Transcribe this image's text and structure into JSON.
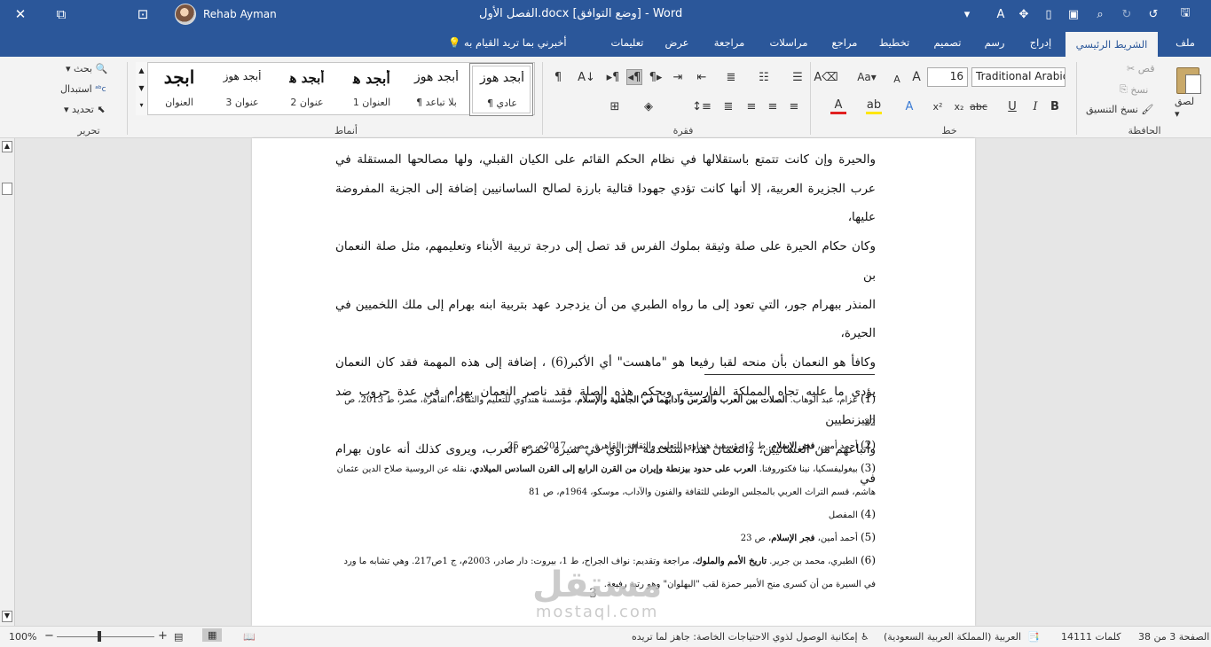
{
  "titlebar": {
    "title": "الفصل الأول.docx  [وضع التوافق]  -  Word",
    "user": "Rehab Ayman",
    "close": "✕",
    "restore": "⧉",
    "ribbon_display": "⊡"
  },
  "tabs": [
    {
      "label": "ملف",
      "active": false
    },
    {
      "label": "الشريط الرئيسي",
      "active": true
    },
    {
      "label": "إدراج",
      "active": false
    },
    {
      "label": "رسم",
      "active": false
    },
    {
      "label": "تصميم",
      "active": false
    },
    {
      "label": "تخطيط",
      "active": false
    },
    {
      "label": "مراجع",
      "active": false
    },
    {
      "label": "مراسلات",
      "active": false
    },
    {
      "label": "مراجعة",
      "active": false
    },
    {
      "label": "عرض",
      "active": false
    },
    {
      "label": "تعليمات",
      "active": false
    }
  ],
  "tellme": "أخبرني بما تريد القيام به",
  "ribbon": {
    "clipboard": {
      "label": "الحافظة",
      "paste": "لصق",
      "cut": "قص",
      "copy": "نسخ",
      "format_painter": "نسخ التنسيق"
    },
    "font": {
      "label": "خط",
      "font_name": "Traditional Arabic",
      "font_size": "16"
    },
    "paragraph": {
      "label": "فقرة"
    },
    "styles": {
      "label": "أنماط",
      "items": [
        {
          "preview": "أبجد هوز",
          "name": "¶ عادي"
        },
        {
          "preview": "أبجد هوز",
          "name": "¶ بلا تباعد"
        },
        {
          "preview": "أبجد ﮬ",
          "name": "العنوان 1"
        },
        {
          "preview": "أبجد ﮬ",
          "name": "عنوان 2"
        },
        {
          "preview": "أبجد هوز",
          "name": "عنوان 3"
        },
        {
          "preview": "ابجد",
          "name": "العنوان"
        }
      ]
    },
    "editing": {
      "label": "تحرير",
      "find": "بحث",
      "replace": "استبدال",
      "select": "تحديد"
    }
  },
  "document": {
    "body_lines": [
      "والحيرة وإن كانت تتمتع باستقلالها في نظام الحكم القائم على الكيان القبلي، ولها مصالحها المستقلة في",
      "عرب الجزيرة العربية، إلا أنها كانت تؤدي جهودا قتالية بارزة لصالح الساسانيين إضافة إلى الجزية المفروضة عليها،",
      "وكان حكام الحيرة على صلة وثيقة بملوك الفرس قد تصل إلى درجة تربية الأبناء وتعليمهم، مثل صلة النعمان بن",
      "المنذر ببهرام جور، التي تعود إلى ما رواه الطبري من أن يزدجرد عهد بتربية ابنه بهرام إلى ملك اللخميين في الحيرة،",
      "وكافأ هو النعمان بأن منحه لقبا رفيعا هو \"ماهست\" أي الأكبر(6) ، إضافة إلى هذه المهمة فقد كان النعمان",
      "يؤدي ما عليه تجاه المملكة الفارسية، وبحكم هذه الصلة فقد ناصر النعمان بهرام في عدة حروب ضد البيزنطيين",
      "وأتباعهم من الغسانيين، والنعمان هذا استخدمه الراوي في سيرة حمزة العرب، ويروى كذلك أنه عاون بهرام في"
    ],
    "footnotes": [
      {
        "num": "(1)",
        "pre": " عزام، عبد الوهاب. ",
        "bold": "الصلات بين العرب والفرس وآدابهما في الجاهلية والإسلام",
        "post": "، مؤسسة هنداوي للتعليم والثقافة، القاهرة، مصر، ط 2013، ص 22"
      },
      {
        "num": "(2)",
        "pre": " أحمد أمين، ",
        "bold": "فجر الإسلام",
        "post": "، ط 2، مؤسسة هنداوي للتعليم والثقافة، القاهرة، مصر، 2017م، ص 25"
      },
      {
        "num": "(3)",
        "pre": " بيغوليفسكيا، نينا فكتوروفنا. ",
        "bold": "العرب على حدود بيزنطة وإيران من القرن الرابع إلى القرن السادس الميلادي",
        "post": "، نقله عن الروسية صلاح الدين عثمان هاشم، قسم التراث العربي بالمجلس الوطني للثقافة والفنون والآداب، موسكو، 1964م، ص 81"
      },
      {
        "num": "(4)",
        "pre": " المفصل",
        "bold": "",
        "post": ""
      },
      {
        "num": "(5)",
        "pre": " أحمد أمين، ",
        "bold": "فجر الإسلام",
        "post": "، ص 23"
      },
      {
        "num": "(6)",
        "pre": " الطبري، محمد بن جرير. ",
        "bold": "تاريخ الأمم والملوك",
        "post": "، مراجعة وتقديم: نواف الجراح، ط 1، بيروت: دار صادر، 2003م، ج 1ص217. وهي تشابه ما ورد في السيرة من أن كسرى منح الأمير حمزة لقب \"البهلوان\" وهو رتبة رفيعة."
      }
    ],
    "page_number": "3"
  },
  "watermark": {
    "arabic": "مستقل",
    "latin": "mostaql.com"
  },
  "statusbar": {
    "page": "الصفحة 3 من 38",
    "words": "14111 كلمات",
    "language": "العربية (المملكة العربية السعودية)",
    "accessibility": "إمكانية الوصول لذوي الاحتياجات الخاصة: جاهز لما تريده",
    "zoom": "100%",
    "zoom_minus": "−",
    "zoom_plus": "+"
  },
  "colors": {
    "accent": "#2b579a",
    "ribbon_bg": "#f3f3f3",
    "workspace": "#e6e6e6"
  }
}
